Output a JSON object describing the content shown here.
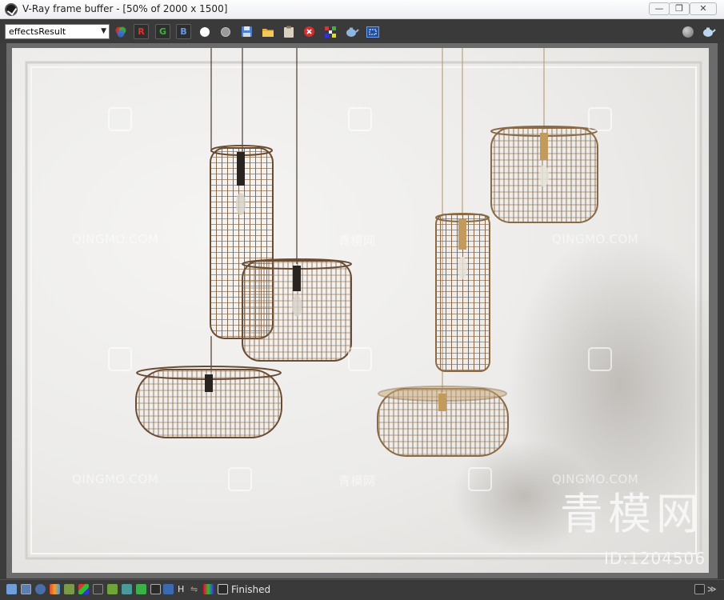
{
  "window": {
    "title": "V-Ray frame buffer - [50% of 2000 x 1500]",
    "buttons": [
      "minimize",
      "restore",
      "close"
    ]
  },
  "toolbar": {
    "channel_value": "effectsResult",
    "channel_labels": {
      "red": "R",
      "green": "G",
      "blue": "B"
    },
    "icons": [
      "rgb-channels-icon",
      "red-channel-button",
      "green-channel-button",
      "blue-channel-button",
      "white-circle-icon",
      "gray-circle-icon",
      "save-icon",
      "open-folder-icon",
      "clipboard-icon",
      "clear-icon",
      "track-mouse-icon",
      "teapot-render-icon",
      "region-render-icon",
      "settings-sphere-icon",
      "teapot-icon"
    ]
  },
  "render": {
    "watermarks": [
      "QINGMO.COM",
      "青模网"
    ],
    "brand_text": "青模网",
    "id_text": "ID:1204506"
  },
  "statusbar": {
    "status_text": "Finished",
    "expand_glyph": "≫"
  },
  "colors": {
    "chrome": "#3a3a3a",
    "accent_red": "#e0312b",
    "accent_green": "#3fb33a",
    "accent_blue": "#3a70d8"
  }
}
